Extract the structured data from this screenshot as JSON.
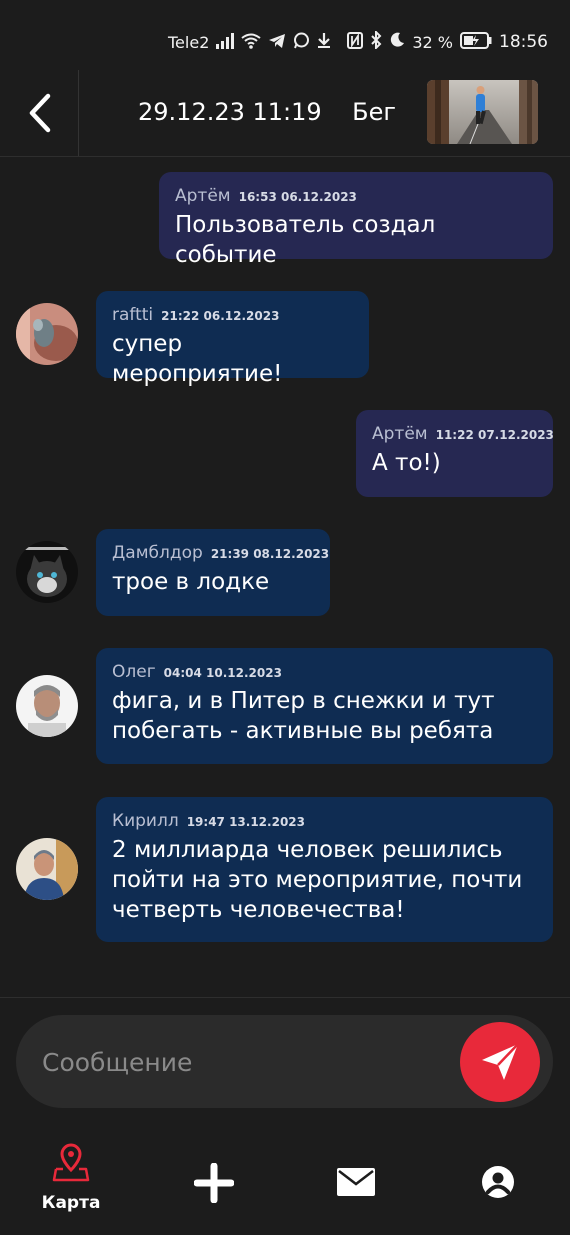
{
  "status_bar": {
    "carrier": "Tele2",
    "battery": "32 %",
    "time": "18:56",
    "icons": [
      "signal-icon",
      "wifi-icon",
      "telegram-icon",
      "whatsapp-icon",
      "download-icon",
      "nfc-icon",
      "bluetooth-icon",
      "moon-icon",
      "battery-icon"
    ]
  },
  "header": {
    "title": "29.12.23 11:19    Бег",
    "back_icon": "chevron-left-icon",
    "thumbnail": "runner-photo"
  },
  "messages": [
    {
      "author": "Артём",
      "time": "16:53 06.12.2023",
      "text": "Пользователь создал событие",
      "direction": "out"
    },
    {
      "author": "raftti",
      "time": "21:22 06.12.2023",
      "text": "супер мероприятие!",
      "direction": "in",
      "avatar": "avatar-raftti"
    },
    {
      "author": "Артём",
      "time": "11:22 07.12.2023",
      "text": "А то!)",
      "direction": "out"
    },
    {
      "author": "Дамблдор",
      "time": "21:39 08.12.2023",
      "text": "трое в лодке",
      "direction": "in",
      "avatar": "avatar-dumbledore"
    },
    {
      "author": "Олег",
      "time": "04:04 10.12.2023",
      "text_lines": [
        "фига, и в Питер в снежки и тут",
        "побегать - активные вы ребята"
      ],
      "direction": "in",
      "avatar": "avatar-oleg"
    },
    {
      "author": "Кирилл",
      "time": "19:47 13.12.2023",
      "text_lines": [
        "2 миллиарда человек решились",
        "пойти на это мероприятие, почти",
        "четверть человечества!"
      ],
      "direction": "in",
      "avatar": "avatar-kirill"
    }
  ],
  "composer": {
    "placeholder": "Сообщение",
    "send_icon": "send-icon"
  },
  "nav": {
    "map_label": "Карта",
    "items": [
      "map-pin-icon",
      "plus-icon",
      "mail-icon",
      "profile-icon"
    ]
  },
  "colors": {
    "background": "#1c1c1c",
    "outgoing_bubble": "#262852",
    "incoming_bubble": "#0f2c52",
    "accent": "#e8293a"
  }
}
